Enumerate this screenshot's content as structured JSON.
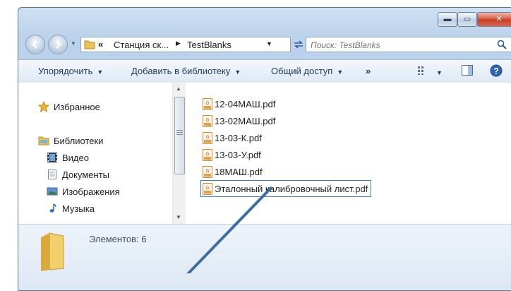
{
  "address": {
    "overflow": "«",
    "crumbs": [
      "Станция ск...",
      "TestBlanks"
    ]
  },
  "search": {
    "placeholder": "Поиск: TestBlanks"
  },
  "toolbar": {
    "organize": "Упорядочить",
    "add_library": "Добавить в библиотеку",
    "share": "Общий доступ",
    "more": "»"
  },
  "nav": {
    "favorites": "Избранное",
    "libraries": "Библиотеки",
    "items": [
      "Видео",
      "Документы",
      "Изображения",
      "Музыка"
    ]
  },
  "files": [
    "12-04МАШ.pdf",
    "13-02МАШ.pdf",
    "13-03-К.pdf",
    "13-03-У.pdf",
    "18МАШ.pdf",
    "Эталонный калибровочный лист.pdf"
  ],
  "details": {
    "count": "Элементов: 6"
  },
  "colors": {
    "selection": "#3c78c8",
    "pointer": "#3f6ea0",
    "toolbar_text": "#1e395b"
  }
}
